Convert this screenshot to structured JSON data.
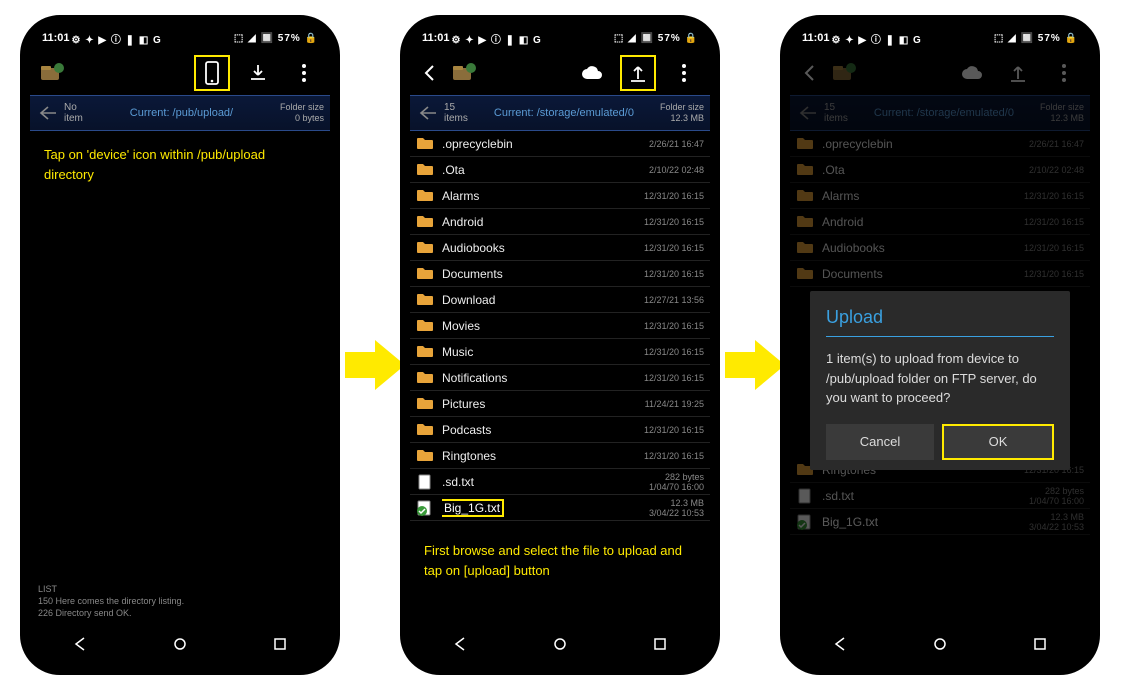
{
  "status": {
    "time": "11:01",
    "icons_left": "⚙ ✦ ▶ ⓘ ❚ ◧ G",
    "icons_right": "⬚ ◢ 🔲 57% 🔒"
  },
  "screen1": {
    "path_count_lbl": "No",
    "path_count_val": "item",
    "current": "Current: /pub/upload/",
    "folder_lbl": "Folder size",
    "folder_val": "0 bytes",
    "instruction": "Tap on 'device' icon within /pub/upload directory",
    "log_lines": [
      "LIST",
      "150 Here comes the directory listing.",
      "226 Directory send OK."
    ]
  },
  "screen2": {
    "path_count_lbl": "15",
    "path_count_val": "items",
    "current": "Current: /storage/emulated/0",
    "folder_lbl": "Folder size",
    "folder_val": "12.3 MB",
    "instruction": "First browse and select the file to upload and tap on [upload] button",
    "files": [
      {
        "name": ".oprecyclebin",
        "meta1": "",
        "meta2": "2/26/21 16:47",
        "type": "folder"
      },
      {
        "name": ".Ota",
        "meta1": "",
        "meta2": "2/10/22 02:48",
        "type": "folder"
      },
      {
        "name": "Alarms",
        "meta1": "",
        "meta2": "12/31/20 16:15",
        "type": "folder"
      },
      {
        "name": "Android",
        "meta1": "",
        "meta2": "12/31/20 16:15",
        "type": "folder"
      },
      {
        "name": "Audiobooks",
        "meta1": "",
        "meta2": "12/31/20 16:15",
        "type": "folder"
      },
      {
        "name": "Documents",
        "meta1": "",
        "meta2": "12/31/20 16:15",
        "type": "folder"
      },
      {
        "name": "Download",
        "meta1": "",
        "meta2": "12/27/21 13:56",
        "type": "folder"
      },
      {
        "name": "Movies",
        "meta1": "",
        "meta2": "12/31/20 16:15",
        "type": "folder"
      },
      {
        "name": "Music",
        "meta1": "",
        "meta2": "12/31/20 16:15",
        "type": "folder"
      },
      {
        "name": "Notifications",
        "meta1": "",
        "meta2": "12/31/20 16:15",
        "type": "folder"
      },
      {
        "name": "Pictures",
        "meta1": "",
        "meta2": "11/24/21 19:25",
        "type": "folder"
      },
      {
        "name": "Podcasts",
        "meta1": "",
        "meta2": "12/31/20 16:15",
        "type": "folder"
      },
      {
        "name": "Ringtones",
        "meta1": "",
        "meta2": "12/31/20 16:15",
        "type": "folder"
      },
      {
        "name": ".sd.txt",
        "meta1": "282 bytes",
        "meta2": "1/04/70 16:00",
        "type": "file"
      },
      {
        "name": "Big_1G.txt",
        "meta1": "12.3 MB",
        "meta2": "3/04/22 10:53",
        "type": "file",
        "selected": true,
        "highlight": true
      }
    ]
  },
  "screen3": {
    "path_count_lbl": "15",
    "path_count_val": "items",
    "current": "Current: /storage/emulated/0",
    "folder_lbl": "Folder size",
    "folder_val": "12.3 MB",
    "dialog": {
      "title": "Upload",
      "message": "1 item(s) to upload from device to /pub/upload folder on FTP server, do you want to proceed?",
      "cancel": "Cancel",
      "ok": "OK"
    },
    "files": [
      {
        "name": ".oprecyclebin",
        "meta2": "2/26/21 16:47",
        "type": "folder"
      },
      {
        "name": ".Ota",
        "meta2": "2/10/22 02:48",
        "type": "folder"
      },
      {
        "name": "Alarms",
        "meta2": "12/31/20 16:15",
        "type": "folder"
      },
      {
        "name": "Android",
        "meta2": "12/31/20 16:15",
        "type": "folder"
      },
      {
        "name": "Audiobooks",
        "meta2": "12/31/20 16:15",
        "type": "folder"
      },
      {
        "name": "Documents",
        "meta2": "12/31/20 16:15",
        "type": "folder"
      },
      {
        "name": "Ringtones",
        "meta1": "",
        "meta2": "12/31/20 16:15",
        "type": "folder"
      },
      {
        "name": ".sd.txt",
        "meta1": "282 bytes",
        "meta2": "1/04/70 16:00",
        "type": "file"
      },
      {
        "name": "Big_1G.txt",
        "meta1": "12.3 MB",
        "meta2": "3/04/22 10:53",
        "type": "file",
        "selected": true
      }
    ]
  }
}
